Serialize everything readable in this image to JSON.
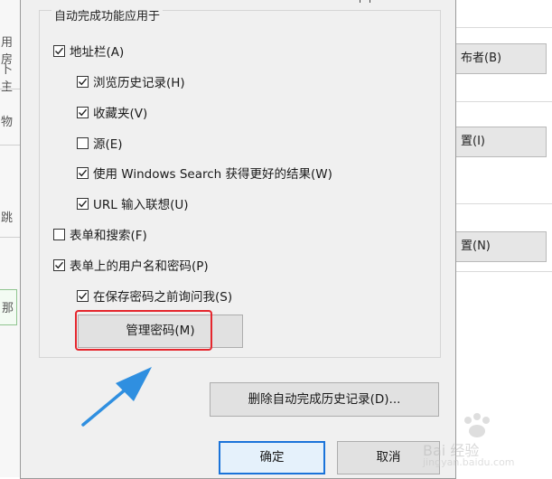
{
  "background_window": {
    "left_fragments": [
      "用房",
      "卜主",
      "物",
      "跳",
      "那"
    ],
    "right_buttons": [
      "布者(B)",
      "置(I)",
      "置(N)"
    ]
  },
  "dialog": {
    "group_title": "自动完成功能应用于",
    "options": [
      {
        "label": "地址栏(A)",
        "checked": true
      },
      {
        "label": "浏览历史记录(H)",
        "checked": true
      },
      {
        "label": "收藏夹(V)",
        "checked": true
      },
      {
        "label": "源(E)",
        "checked": false
      },
      {
        "label": "使用 Windows Search 获得更好的结果(W)",
        "checked": true
      },
      {
        "label": "URL 输入联想(U)",
        "checked": true
      },
      {
        "label": "表单和搜索(F)",
        "checked": false
      },
      {
        "label": "表单上的用户名和密码(P)",
        "checked": true
      },
      {
        "label": "在保存密码之前询问我(S)",
        "checked": true
      }
    ],
    "manage_passwords_label": "管理密码(M)",
    "delete_history_label": "删除自动完成历史记录(D)...",
    "ok_label": "确定",
    "cancel_label": "取消"
  },
  "watermark": {
    "text": "Bai 经验",
    "subtext": "jingyan.baidu.com"
  },
  "colors": {
    "highlight": "#e5262d",
    "arrow": "#2f8fe0",
    "primary_border": "#1a73d9"
  }
}
